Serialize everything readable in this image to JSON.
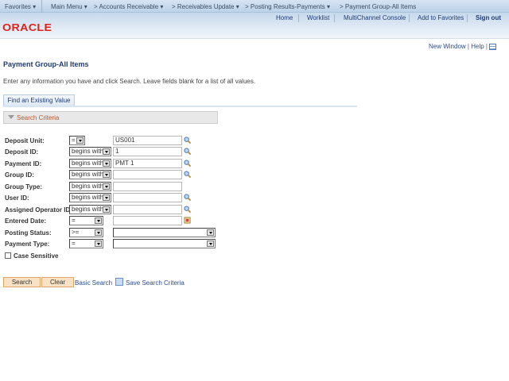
{
  "topnav": {
    "favorites": "Favorites",
    "main_menu": "Main Menu",
    "crumbs": [
      "Accounts Receivable",
      "Receivables Update",
      "Posting Results-Payments",
      "Payment Group-All Items"
    ]
  },
  "header": {
    "links": [
      "Home",
      "Worklist",
      "MultiChannel Console",
      "Add to Favorites"
    ],
    "signout": "Sign out",
    "logo": "ORACLE"
  },
  "util": {
    "new_window": "New Window",
    "help": "Help"
  },
  "page": {
    "title": "Payment Group-All Items",
    "instructions": "Enter any information you have and click Search. Leave fields blank for a list of all values.",
    "tab": "Find an Existing Value",
    "section": "Search Criteria"
  },
  "fields": [
    {
      "label": "Deposit Unit:",
      "op": "=",
      "value": "US001",
      "lookup": true
    },
    {
      "label": "Deposit ID:",
      "op": "begins with",
      "value": "1",
      "lookup": true
    },
    {
      "label": "Payment ID:",
      "op": "begins with",
      "value": "PMT 1",
      "lookup": true
    },
    {
      "label": "Group ID:",
      "op": "begins with",
      "value": "",
      "lookup": true
    },
    {
      "label": "Group Type:",
      "op": "begins with",
      "value": "",
      "lookup": false
    },
    {
      "label": "User ID:",
      "op": "begins with",
      "value": "",
      "lookup": true
    },
    {
      "label": "Assigned Operator ID:",
      "op": "begins with",
      "value": "",
      "lookup": true
    },
    {
      "label": "Entered Date:",
      "op": "=",
      "value": "",
      "calendar": true
    },
    {
      "label": "Posting Status:",
      "op": ">=",
      "value": ""
    },
    {
      "label": "Payment Type:",
      "op": "=",
      "value": ""
    }
  ],
  "case_sensitive": {
    "label": "Case Sensitive",
    "checked": false
  },
  "actions": {
    "search": "Search",
    "clear": "Clear",
    "basic": "Basic Search",
    "save": "Save Search Criteria"
  }
}
